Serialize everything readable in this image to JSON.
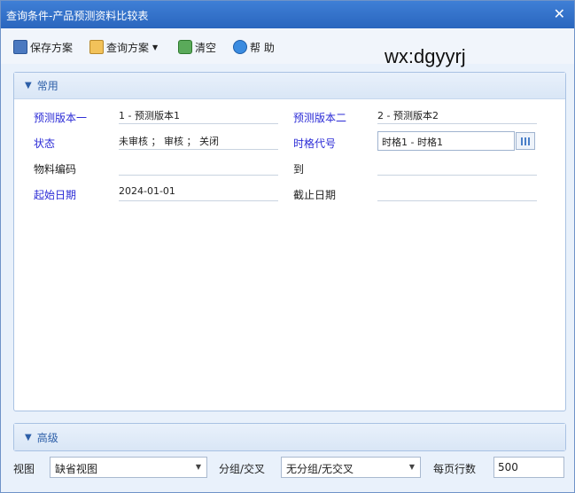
{
  "window": {
    "title": "查询条件-产品预测资料比较表"
  },
  "toolbar": {
    "save": "保存方案",
    "query_scheme": "查询方案",
    "clear": "清空",
    "help": "帮 助"
  },
  "watermark": "wx:dgyyrj",
  "common": {
    "title": "常用",
    "forecast_v1_label": "预测版本一",
    "forecast_v1_value": "1 - 预测版本1",
    "forecast_v2_label": "预测版本二",
    "forecast_v2_value": "2 - 预测版本2",
    "status_label": "状态",
    "status_value": "未审核 ； 审核 ； 关闭",
    "timegrid_label": "时格代号",
    "timegrid_value": "时格1 - 时格1",
    "material_label": "物料编码",
    "material_value": "",
    "to_label": "到",
    "to_value": "",
    "start_date_label": "起始日期",
    "start_date_value": "2024-01-01",
    "end_date_label": "截止日期",
    "end_date_value": ""
  },
  "advanced": {
    "title": "高级"
  },
  "bottom": {
    "view_label": "视图",
    "view_value": "缺省视图",
    "group_label": "分组/交叉",
    "group_value": "无分组/无交叉",
    "rows_label": "每页行数",
    "rows_value": "500"
  },
  "colors": {
    "titlebar": "#2a66be",
    "blue_label": "#2b2bd6",
    "panel_border": "#a9c2e3"
  }
}
